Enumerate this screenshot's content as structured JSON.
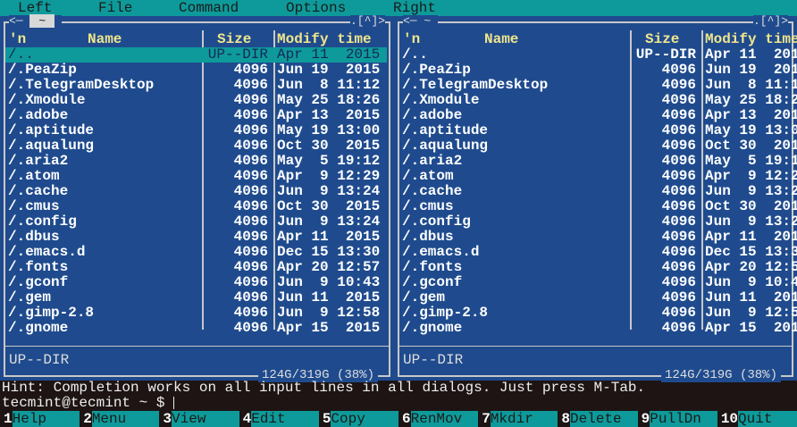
{
  "menu": [
    "Left",
    "File",
    "Command",
    "Options",
    "Right"
  ],
  "panels": [
    {
      "cwd": "~",
      "title_right": ".[^]>",
      "mini_status": "UP--DIR",
      "free": "124G/319G (38%)"
    },
    {
      "cwd": "~",
      "title_right": ".[^]>",
      "mini_status": "UP--DIR",
      "free": "124G/319G (38%)"
    }
  ],
  "headers": {
    "sort": "'n",
    "name": "Name",
    "size": "Size",
    "mtime": "Modify time"
  },
  "files": [
    {
      "name": "/..",
      "size": "UP--DIR",
      "mtime": "Apr 11  2015"
    },
    {
      "name": "/.PeaZip",
      "size": "4096",
      "mtime": "Jun 19  2015"
    },
    {
      "name": "/.TelegramDesktop",
      "size": "4096",
      "mtime": "Jun  8 11:12"
    },
    {
      "name": "/.Xmodule",
      "size": "4096",
      "mtime": "May 25 18:26"
    },
    {
      "name": "/.adobe",
      "size": "4096",
      "mtime": "Apr 13  2015"
    },
    {
      "name": "/.aptitude",
      "size": "4096",
      "mtime": "May 19 13:00"
    },
    {
      "name": "/.aqualung",
      "size": "4096",
      "mtime": "Oct 30  2015"
    },
    {
      "name": "/.aria2",
      "size": "4096",
      "mtime": "May  5 19:12"
    },
    {
      "name": "/.atom",
      "size": "4096",
      "mtime": "Apr  9 12:29"
    },
    {
      "name": "/.cache",
      "size": "4096",
      "mtime": "Jun  9 13:24"
    },
    {
      "name": "/.cmus",
      "size": "4096",
      "mtime": "Oct 30  2015"
    },
    {
      "name": "/.config",
      "size": "4096",
      "mtime": "Jun  9 13:24"
    },
    {
      "name": "/.dbus",
      "size": "4096",
      "mtime": "Apr 11  2015"
    },
    {
      "name": "/.emacs.d",
      "size": "4096",
      "mtime": "Dec 15 13:30"
    },
    {
      "name": "/.fonts",
      "size": "4096",
      "mtime": "Apr 20 12:57"
    },
    {
      "name": "/.gconf",
      "size": "4096",
      "mtime": "Jun  9 10:43"
    },
    {
      "name": "/.gem",
      "size": "4096",
      "mtime": "Jun 11  2015"
    },
    {
      "name": "/.gimp-2.8",
      "size": "4096",
      "mtime": "Jun  9 12:58"
    },
    {
      "name": "/.gnome",
      "size": "4096",
      "mtime": "Apr 15  2015"
    }
  ],
  "hint": "Hint: Completion works on all input lines in all dialogs. Just press M-Tab.",
  "prompt": "tecmint@tecmint ~ $ ",
  "fkeys": [
    {
      "n": "1",
      "l": "Help"
    },
    {
      "n": "2",
      "l": "Menu"
    },
    {
      "n": "3",
      "l": "View"
    },
    {
      "n": "4",
      "l": "Edit"
    },
    {
      "n": "5",
      "l": "Copy"
    },
    {
      "n": "6",
      "l": "RenMov"
    },
    {
      "n": "7",
      "l": "Mkdir"
    },
    {
      "n": "8",
      "l": "Delete"
    },
    {
      "n": "9",
      "l": "PullDn"
    },
    {
      "n": "10",
      "l": "Quit"
    }
  ],
  "colors": {
    "panel": "#1f4b8e",
    "accent": "#0e9a9a",
    "header": "#f0e68c"
  }
}
